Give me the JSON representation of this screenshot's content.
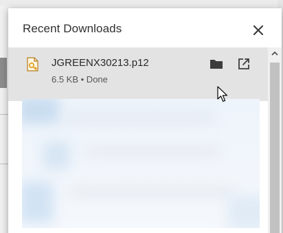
{
  "panel": {
    "title": "Recent Downloads"
  },
  "download": {
    "file_name": "JGREENX30213.p12",
    "status": "6.5 KB • Done"
  },
  "icons": {
    "close": "close-icon",
    "file": "certificate-file-icon",
    "folder": "folder-icon",
    "open": "open-external-icon",
    "scroll_up": "chevron-up-icon",
    "cursor": "mouse-pointer-icon"
  },
  "colors": {
    "item_background": "#e3e3e3",
    "panel_background": "#ffffff",
    "icon_dark": "#3c3c3c",
    "file_icon_accent": "#e0a32e",
    "blur_tint": "#cfe1f3"
  }
}
